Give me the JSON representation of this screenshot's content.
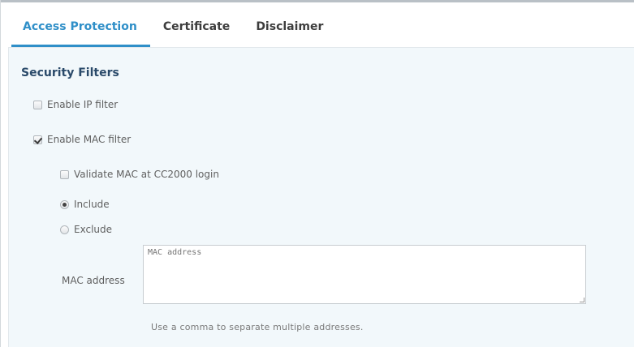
{
  "tabs": [
    {
      "label": "Access Protection",
      "active": true
    },
    {
      "label": "Certificate",
      "active": false
    },
    {
      "label": "Disclaimer",
      "active": false
    }
  ],
  "section": {
    "title": "Security Filters"
  },
  "filters": {
    "ip": {
      "label": "Enable IP filter",
      "checked": false
    },
    "mac": {
      "label": "Enable MAC filter",
      "checked": true
    }
  },
  "mac_options": {
    "validate": {
      "label": "Validate MAC at CC2000 login",
      "checked": false
    },
    "mode": {
      "include": {
        "label": "Include",
        "selected": true
      },
      "exclude": {
        "label": "Exclude",
        "selected": false
      }
    }
  },
  "mac_address": {
    "label": "MAC address",
    "placeholder": "MAC address",
    "value": "",
    "hint": "Use a comma to separate multiple addresses."
  },
  "colors": {
    "accent": "#2f8fc8",
    "panel_bg": "#f2f8fb",
    "section_title": "#2a4a6a"
  }
}
